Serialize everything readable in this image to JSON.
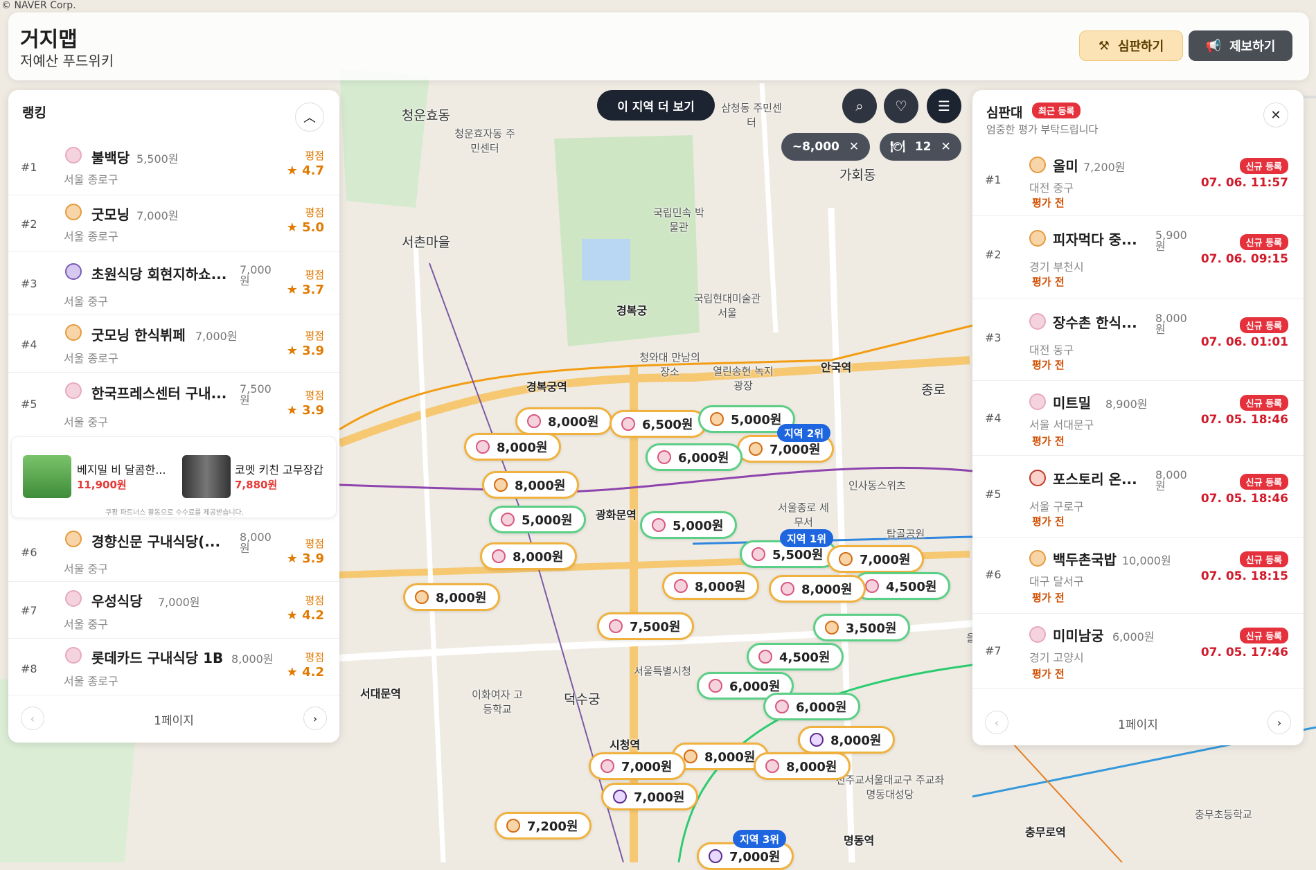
{
  "map": {
    "copyright": "© NAVER Corp.",
    "labels": {
      "cheongunhyodong": "청운효동",
      "cheongunhyoja": "청운효자동 주민센터",
      "samcheong": "삼청동 주민센터",
      "gahoe": "가회동",
      "gyeongbokgung": "경복궁",
      "seochon": "서촌마을",
      "folk": "국립민속 박물관",
      "mmca": "국립현대미술관 서울",
      "anguk": "안국역",
      "jongno": "종로",
      "gwanghwamun": "광화문역",
      "gyeongbokgung_st": "경복궁역",
      "cityhall": "시청역",
      "seodaemun": "서대문역",
      "myeongdong": "명동역",
      "chungmuro": "충무로역",
      "deoksugung": "덕수궁",
      "insadong": "인사동스위츠",
      "euljiro": "을지로",
      "chunggye": "청와대 만남의장소",
      "yeollin": "열린송현 녹지광장",
      "seoul_jongno_tax": "서울종로 세무서",
      "tapgol": "탑골공원",
      "ewha": "이화여자 고등학교",
      "seoulcityhall": "서울특별시청",
      "chungmu_elem": "충무초등학교",
      "cathedral": "천주교서울대교구 주교좌명동대성당"
    }
  },
  "header": {
    "title": "거지맵",
    "subtitle": "저예산 푸드위키",
    "judge_label": "심판하기",
    "report_label": "제보하기"
  },
  "controls": {
    "more_area": "이 지역 더 보기",
    "price_chip": "~8,000",
    "count_chip": "12"
  },
  "ranking": {
    "title": "랭킹",
    "score_label": "평점",
    "items": [
      {
        "rank": "#1",
        "name": "불백당",
        "price": "5,500원",
        "location": "서울 종로구",
        "score": "4.7",
        "icon": "pink"
      },
      {
        "rank": "#2",
        "name": "굿모닝",
        "price": "7,000원",
        "location": "서울 종로구",
        "score": "5.0",
        "icon": "orange"
      },
      {
        "rank": "#3",
        "name": "초원식당 회현지하쇼...",
        "price": "7,000원",
        "location": "서울 중구",
        "score": "3.7",
        "icon": "purple"
      },
      {
        "rank": "#4",
        "name": "굿모닝 한식뷔페",
        "price": "7,000원",
        "location": "서울 종로구",
        "score": "3.9",
        "icon": "orange"
      },
      {
        "rank": "#5",
        "name": "한국프레스센터 구내...",
        "price": "7,500원",
        "location": "서울 중구",
        "score": "3.9",
        "icon": "pink"
      },
      {
        "rank": "#6",
        "name": "경향신문 구내식당(...",
        "price": "8,000원",
        "location": "서울 중구",
        "score": "3.9",
        "icon": "orange"
      },
      {
        "rank": "#7",
        "name": "우성식당",
        "price": "7,000원",
        "location": "서울 중구",
        "score": "4.2",
        "icon": "pink"
      },
      {
        "rank": "#8",
        "name": "롯데카드 구내식당 1B",
        "price": "8,000원",
        "location": "서울 종로구",
        "score": "4.2",
        "icon": "pink"
      }
    ],
    "ad": {
      "item1_name": "베지밀 비 달콤한...",
      "item1_price": "11,900원",
      "item2_name": "코멧 키친 고무장갑",
      "item2_price": "7,880원",
      "note": "쿠팡 파트너스 활동으로 수수료를 제공받습니다."
    },
    "page": "1페이지"
  },
  "board": {
    "title": "심판대",
    "tag": "최근 등록",
    "subtitle": "엄중한 평가 부탁드립니다",
    "new_label": "신규 등록",
    "eval_label": "평가 전",
    "items": [
      {
        "rank": "#1",
        "name": "올미",
        "price": "7,200원",
        "location": "대전 중구",
        "time": "07. 06. 11:57"
      },
      {
        "rank": "#2",
        "name": "피자먹다 중...",
        "price": "5,900원",
        "location": "경기 부천시",
        "time": "07. 06. 09:15"
      },
      {
        "rank": "#3",
        "name": "장수촌 한식...",
        "price": "8,000원",
        "location": "대전 동구",
        "time": "07. 06. 01:01"
      },
      {
        "rank": "#4",
        "name": "미트밀",
        "price": "8,900원",
        "location": "서울 서대문구",
        "time": "07. 05. 18:46"
      },
      {
        "rank": "#5",
        "name": "포스토리 온...",
        "price": "8,000원",
        "location": "서울 구로구",
        "time": "07. 05. 18:46"
      },
      {
        "rank": "#6",
        "name": "백두촌국밥",
        "price": "10,000원",
        "location": "대구 달서구",
        "time": "07. 05. 18:15"
      },
      {
        "rank": "#7",
        "name": "미미남궁",
        "price": "6,000원",
        "location": "경기 고양시",
        "time": "07. 05. 17:46"
      }
    ],
    "page": "1페이지"
  },
  "markers": [
    "8,000원",
    "6,500원",
    "5,000원",
    "7,000원",
    "8,000원",
    "6,000원",
    "8,000원",
    "5,000원",
    "5,000원",
    "8,000원",
    "5,500원",
    "7,000원",
    "8,000원",
    "8,000원",
    "4,500원",
    "8,000원",
    "7,500원",
    "3,500원",
    "4,500원",
    "6,000원",
    "6,000원",
    "8,000원",
    "8,000원",
    "7,000원",
    "8,000원",
    "7,000원",
    "7,200원",
    "7,000원"
  ],
  "regions": {
    "r1": "지역 1위",
    "r2": "지역 2위",
    "r3": "지역 3위"
  }
}
